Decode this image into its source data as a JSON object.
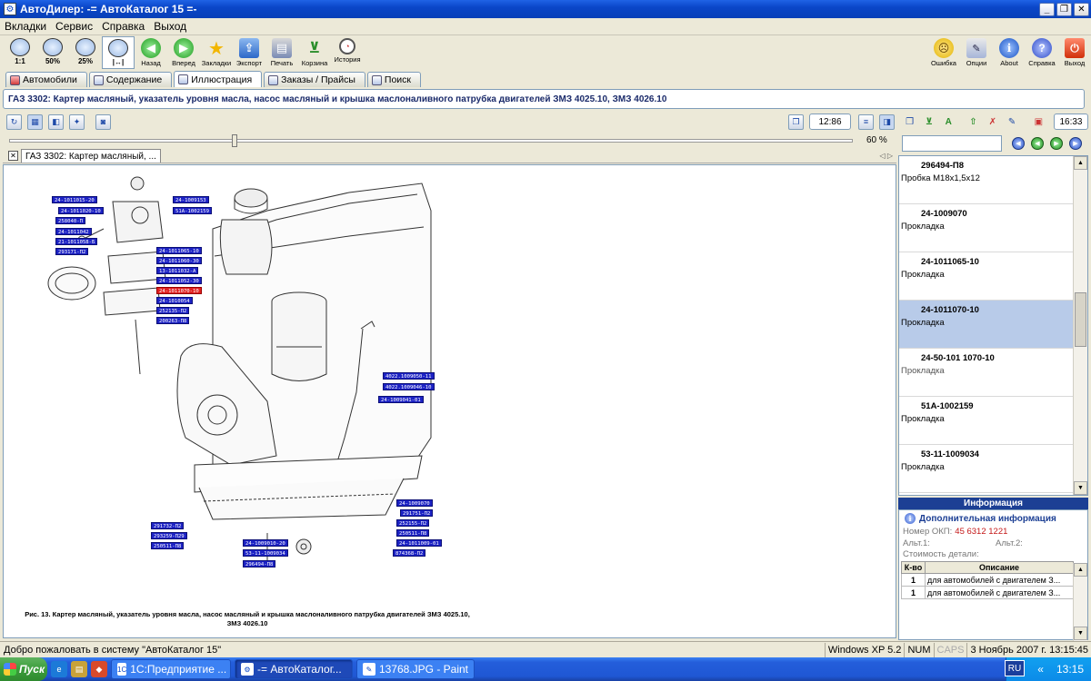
{
  "window": {
    "title": "АвтоДилер: -= АвтоКаталог 15 =-",
    "min": "_",
    "max": "❐",
    "close": "✕"
  },
  "menu": [
    "Вкладки",
    "Сервис",
    "Справка",
    "Выход"
  ],
  "toolbar": {
    "zoom": [
      "1:1",
      "50%",
      "25%",
      "|↔|"
    ],
    "buttons": [
      "Назад",
      "Вперед",
      "Закладки",
      "Экспорт",
      "Печать",
      "Корзина",
      "История"
    ],
    "right": [
      "Ошибка",
      "Опции",
      "About",
      "Справка",
      "Выход"
    ]
  },
  "tabs": [
    "Автомобили",
    "Содержание",
    "Иллюстрация",
    "Заказы / Прайсы",
    "Поиск"
  ],
  "heading": "ГАЗ 3302: Картер масляный, указатель уровня масла, насос масляный и крышка маслоналивного патрубка двигателей ЗМЗ 4025.10, ЗМЗ 4026.10",
  "viewer": {
    "count": "12:86",
    "zoom_value": "60 %",
    "doc_tab": "ГАЗ 3302: Картер масляный, ...",
    "arrows": "◁ ▷",
    "caption": "Рис. 13. Картер масляный, указатель уровня масла, насос масляный и крышка маслоналивного патрубка двигателей ЗМЗ 4025.10, ЗМЗ 4026.10",
    "labels": [
      {
        "text": "24-1011015-20"
      },
      {
        "text": "24-1011020-10"
      },
      {
        "text": "258040-П"
      },
      {
        "text": "24-1011042"
      },
      {
        "text": "21-1011058-Б"
      },
      {
        "text": "293171-П2"
      },
      {
        "text": "24-1009153"
      },
      {
        "text": "51А-1002159"
      },
      {
        "text": "24-1011065-10"
      },
      {
        "text": "24-1011060-30"
      },
      {
        "text": "13-1011032-А"
      },
      {
        "text": "24-1011052-30"
      },
      {
        "text": "24-1011070-10",
        "hl": true
      },
      {
        "text": "24-1010054"
      },
      {
        "text": "252135-П2"
      },
      {
        "text": "200263-П8"
      },
      {
        "text": "4022.1009050-11"
      },
      {
        "text": "4022.1009046-10"
      },
      {
        "text": "24-1009041-01"
      },
      {
        "text": "24-1009070"
      },
      {
        "text": "291751-П2"
      },
      {
        "text": "252155-П2"
      },
      {
        "text": "250511-П8"
      },
      {
        "text": "24-1011009-01"
      },
      {
        "text": "874368-П2"
      },
      {
        "text": "291732-П2"
      },
      {
        "text": "293259-П29"
      },
      {
        "text": "250511-П8"
      },
      {
        "text": "24-1009010-20"
      },
      {
        "text": "53-11-1009034"
      },
      {
        "text": "296494-П8"
      }
    ]
  },
  "right_panel": {
    "time": "16:33",
    "parts": [
      {
        "num": "296494-П8",
        "name": "Пробка М18х1,5х12"
      },
      {
        "num": "24-1009070",
        "name": "Прокладка"
      },
      {
        "num": "24-1011065-10",
        "name": "Прокладка"
      },
      {
        "num": "24-1011070-10",
        "name": "Прокладка",
        "selected": true
      },
      {
        "num": "24-50-101 1070-10",
        "name": "Прокладка",
        "grey": true
      },
      {
        "num": "51А-1002159",
        "name": "Прокладка"
      },
      {
        "num": "53-11-1009034",
        "name": "Прокладка"
      }
    ],
    "info_header": "Информация",
    "info_title": "Дополнительная информация",
    "okp_label": "Номер ОКП:",
    "okp_value": "45 6312 1221",
    "alt1": "Альт.1:",
    "alt2": "Альт.2:",
    "cost": "Стоимость детали:",
    "table_headers": [
      "К-во",
      "Описание"
    ],
    "table_rows": [
      {
        "qty": "1",
        "desc": "для автомобилей с двигателем З..."
      },
      {
        "qty": "1",
        "desc": "для автомобилей с двигателем З..."
      }
    ]
  },
  "status": {
    "message": "Добро пожаловать в систему \"АвтоКаталог 15\"",
    "os": "Windows XP 5.2",
    "num": "NUM",
    "caps": "CAPS",
    "datetime": "3 Ноябрь 2007 г. 13:15:45"
  },
  "taskbar": {
    "start": "Пуск",
    "tasks": [
      "1С:Предприятие ...",
      "-= АвтоКаталог...",
      "13768.JPG - Paint"
    ],
    "lang": "RU",
    "chevron": "«",
    "clock": "13:15"
  }
}
